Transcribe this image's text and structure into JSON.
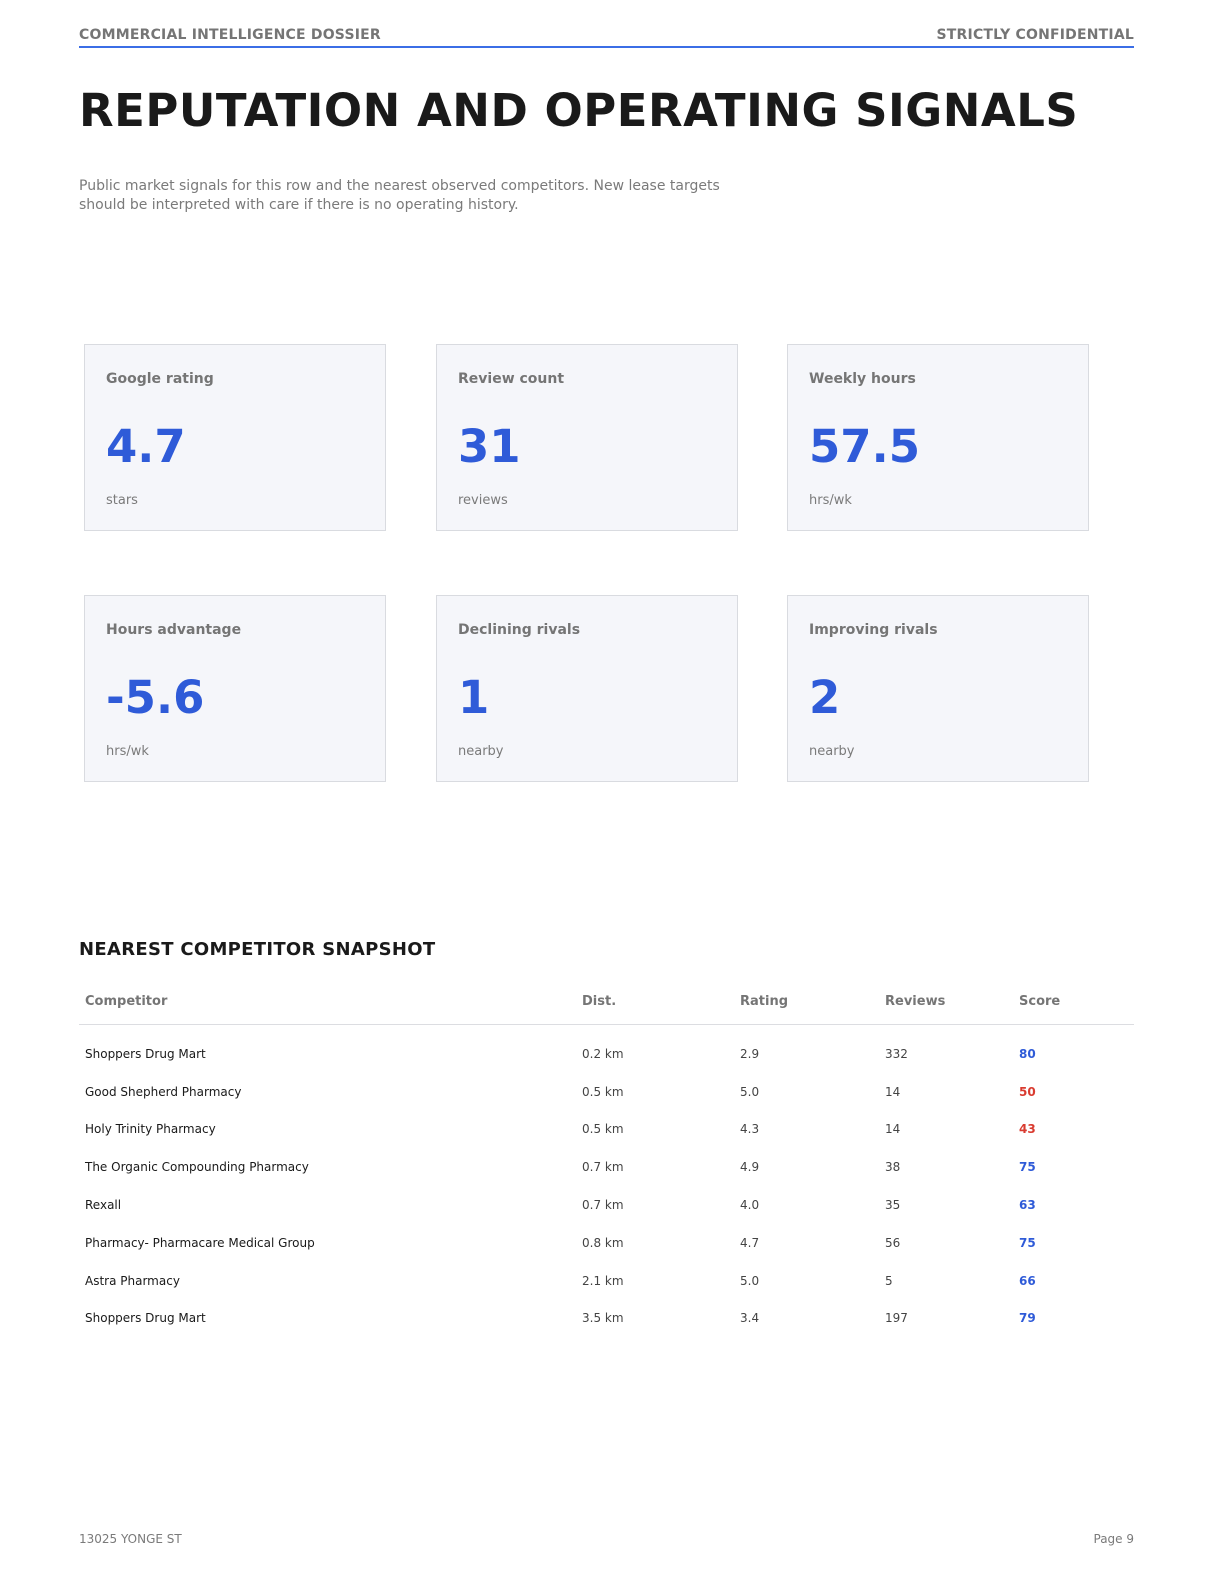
{
  "header": {
    "left": "COMMERCIAL INTELLIGENCE DOSSIER",
    "right": "STRICTLY CONFIDENTIAL"
  },
  "title": "REPUTATION AND OPERATING SIGNALS",
  "intro": "Public market signals for this row and the nearest observed competitors. New lease targets should be interpreted with care if there is no operating history.",
  "cards": [
    {
      "label": "Google rating",
      "value": "4.7",
      "unit": "stars"
    },
    {
      "label": "Review count",
      "value": "31",
      "unit": "reviews"
    },
    {
      "label": "Weekly hours",
      "value": "57.5",
      "unit": "hrs/wk"
    },
    {
      "label": "Hours advantage",
      "value": "-5.6",
      "unit": "hrs/wk"
    },
    {
      "label": "Declining rivals",
      "value": "1",
      "unit": "nearby"
    },
    {
      "label": "Improving rivals",
      "value": "2",
      "unit": "nearby"
    }
  ],
  "colors": {
    "accent": "#2f5bd8",
    "score_high": "#2f5bd8",
    "score_low": "#d93b30",
    "rule": "#3b6ee6"
  },
  "competitors": {
    "title": "NEAREST COMPETITOR SNAPSHOT",
    "columns": [
      "Competitor",
      "Dist.",
      "Rating",
      "Reviews",
      "Score"
    ],
    "rows": [
      {
        "name": "Shoppers Drug Mart",
        "dist": "0.2 km",
        "rating": "2.9",
        "reviews": "332",
        "score": "80",
        "score_color": "#2f5bd8"
      },
      {
        "name": "Good Shepherd Pharmacy",
        "dist": "0.5 km",
        "rating": "5.0",
        "reviews": "14",
        "score": "50",
        "score_color": "#d93b30"
      },
      {
        "name": "Holy Trinity Pharmacy",
        "dist": "0.5 km",
        "rating": "4.3",
        "reviews": "14",
        "score": "43",
        "score_color": "#d93b30"
      },
      {
        "name": "The Organic Compounding Pharmacy",
        "dist": "0.7 km",
        "rating": "4.9",
        "reviews": "38",
        "score": "75",
        "score_color": "#2f5bd8"
      },
      {
        "name": "Rexall",
        "dist": "0.7 km",
        "rating": "4.0",
        "reviews": "35",
        "score": "63",
        "score_color": "#2f5bd8"
      },
      {
        "name": "Pharmacy- Pharmacare Medical Group",
        "dist": "0.8 km",
        "rating": "4.7",
        "reviews": "56",
        "score": "75",
        "score_color": "#2f5bd8"
      },
      {
        "name": "Astra Pharmacy",
        "dist": "2.1 km",
        "rating": "5.0",
        "reviews": "5",
        "score": "66",
        "score_color": "#2f5bd8"
      },
      {
        "name": "Shoppers Drug Mart",
        "dist": "3.5 km",
        "rating": "3.4",
        "reviews": "197",
        "score": "79",
        "score_color": "#2f5bd8"
      }
    ]
  },
  "footer": {
    "left": "13025 YONGE ST",
    "right": "Page 9"
  }
}
